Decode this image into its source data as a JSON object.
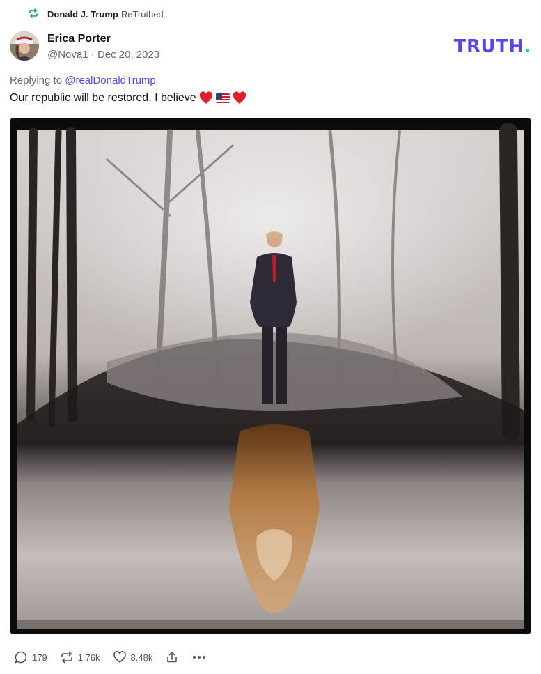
{
  "retruth": {
    "user": "Donald J. Trump",
    "action": "ReTruthed",
    "icon": "retruth-icon"
  },
  "post": {
    "author_name": "Erica Porter",
    "handle": "@Nova1",
    "separator": "·",
    "date": "Dec 20, 2023",
    "reply_prefix": "Replying to",
    "reply_to": "@realDonaldTrump",
    "text": "Our republic will be restored. I believe"
  },
  "brand": {
    "logo_text": "TRUTH",
    "logo_dot": ".",
    "accent": "#5448ee",
    "dot_color": "#0fd39b"
  },
  "actions": {
    "replies": "179",
    "retruths": "1.76k",
    "likes": "8.48k"
  }
}
